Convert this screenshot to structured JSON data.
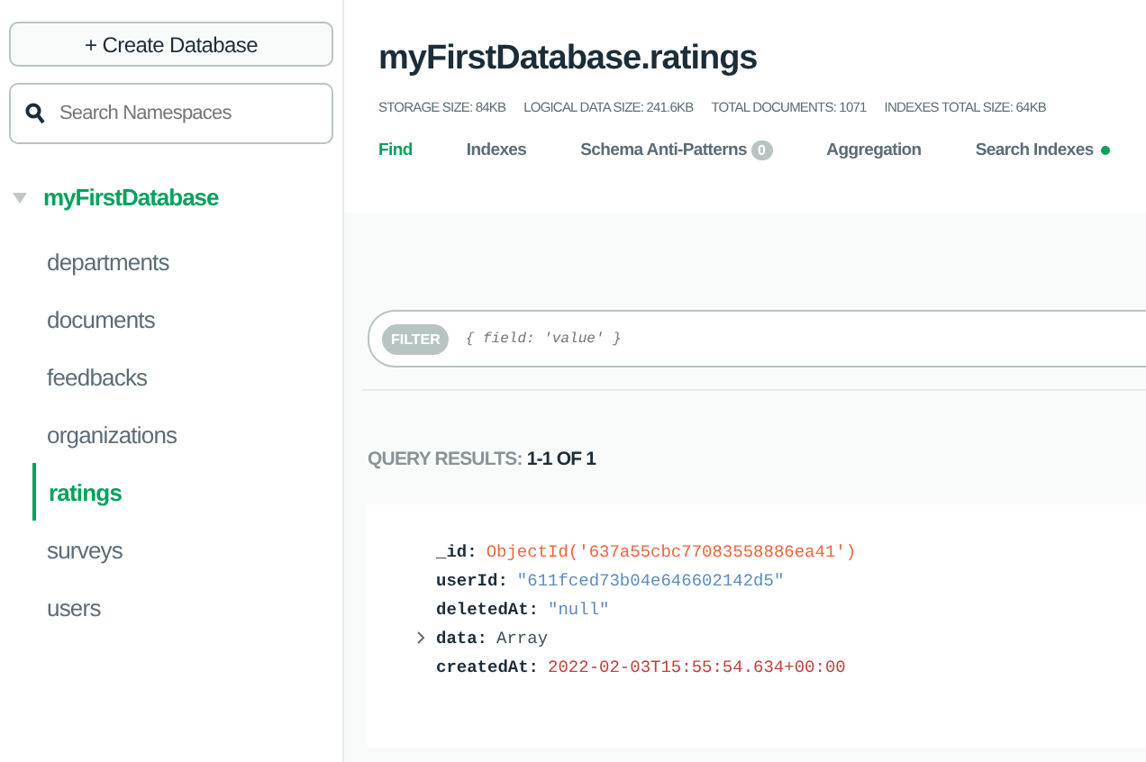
{
  "sidebar": {
    "create_button": "+ Create Database",
    "search": {
      "placeholder": "Search Namespaces"
    },
    "database": {
      "name": "myFirstDatabase",
      "expanded": true,
      "collections": [
        {
          "name": "departments",
          "selected": false
        },
        {
          "name": "documents",
          "selected": false
        },
        {
          "name": "feedbacks",
          "selected": false
        },
        {
          "name": "organizations",
          "selected": false
        },
        {
          "name": "ratings",
          "selected": true
        },
        {
          "name": "surveys",
          "selected": false
        },
        {
          "name": "users",
          "selected": false
        }
      ]
    }
  },
  "header": {
    "title": "myFirstDatabase.ratings",
    "stats": [
      "STORAGE SIZE: 84KB",
      "LOGICAL DATA SIZE: 241.6KB",
      "TOTAL DOCUMENTS: 1071",
      "INDEXES TOTAL SIZE: 64KB"
    ]
  },
  "tabs": [
    {
      "label": "Find",
      "selected": true,
      "indicator": false
    },
    {
      "label": "Indexes",
      "selected": false,
      "indicator": false
    },
    {
      "label": "Schema Anti-Patterns",
      "selected": false,
      "indicator": false,
      "badge": "0"
    },
    {
      "label": "Aggregation",
      "selected": false,
      "indicator": false
    },
    {
      "label": "Search Indexes",
      "selected": false,
      "indicator": true
    }
  ],
  "filter": {
    "label": "FILTER",
    "placeholder": "{ field: 'value' }"
  },
  "query_results": {
    "label": "QUERY RESULTS:",
    "value": "1-1 OF 1"
  },
  "document": [
    {
      "key": "_id:",
      "value": "ObjectId('637a55cbc77083558886ea41')",
      "kind": "objectid"
    },
    {
      "key": "userId:",
      "value": "\"611fced73b04e646602142d5\"",
      "kind": "string"
    },
    {
      "key": "deletedAt:",
      "value": "\"null\"",
      "kind": "string"
    },
    {
      "key": "data:",
      "value": "Array",
      "kind": "array"
    },
    {
      "key": "createdAt:",
      "value": "2022-02-03T15:55:54.634+00:00",
      "kind": "date"
    }
  ]
}
